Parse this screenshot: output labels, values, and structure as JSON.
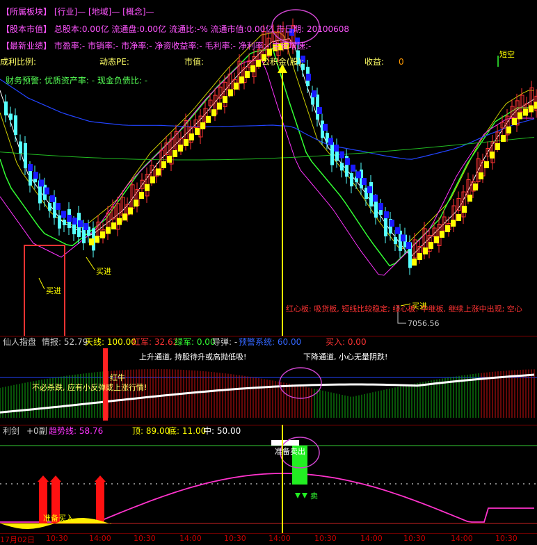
{
  "info_lines": [
    {
      "text": "【所属板块】 [行业]— [地域]— [概念]—",
      "color": "#ff55ff"
    },
    {
      "text": "【股本市值】 总股本:0.00亿 流通盘:0.00亿 流通比:-% 流通市值:0.00亿  市日期: 20100608",
      "color": "#ff55ff"
    },
    {
      "text": "【最新业绩】 市盈率:- 市销率:- 市净率:- 净资收益率:- 毛利率:- 净利率:- 主营增速:-",
      "color": "#ff55ff"
    }
  ],
  "info_row4": {
    "label1": "成利比例:",
    "label2": "动态PE:",
    "label3": "市值:",
    "label4": "公积金(股):",
    "label5": "收益:",
    "value5": "0"
  },
  "info_row5": "财务预警: 优质资产率: - 现金负债比: -",
  "main_annotations": {
    "buy1": "买进",
    "buy2": "买进",
    "buy3": "买进",
    "low_price": "7056.56",
    "short": "短空",
    "hint": "红心板: 吸货板, 短线比较稳定; 绿心板: 中继板, 继续上涨中出现; 空心"
  },
  "ind1_header": {
    "name": "仙人指盘",
    "info": "情报: 52.79",
    "sky": "天线: 100.00",
    "red": "红军: 32.62",
    "green": "绿军: 0.00",
    "guide": "导弹: -",
    "extra": "预警系统: 60.00",
    "buy": "买入: 0.00"
  },
  "ind1_annotations": {
    "up": "上升通道, 持股待升或高抛低吸!",
    "down": "下降通道, 小心无量阴跌!",
    "hold": "不必杀跌, 应有小反弹或上涨行情!",
    "redcow": "红牛"
  },
  "ind2_header": {
    "name": "利剑",
    "pane": "+0副",
    "trend": "趋势线: 58.76",
    "top": "顶: 89.00",
    "bottom": "底: 11.00",
    "mid": "中: 50.00"
  },
  "ind2_annotations": {
    "ready_buy": "准备买入",
    "ready_sell": "准备卖出",
    "sell": "卖"
  },
  "time_axis": [
    "17月02日",
    "10:30",
    "14:00",
    "10:30",
    "14:00",
    "10:30",
    "14:00",
    "10:30",
    "14:00",
    "10:30",
    "14:00",
    "10:30"
  ],
  "colors": {
    "up_candle": "#ff3333",
    "down_candle": "#55ffff",
    "yellow": "#ffff00",
    "blue": "#1a1aff",
    "green": "#33ff33",
    "magenta": "#ff33ff",
    "white": "#ffffff"
  }
}
